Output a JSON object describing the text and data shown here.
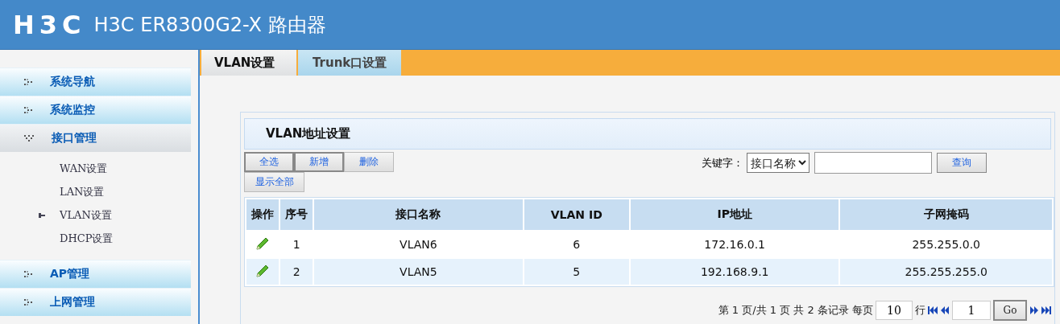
{
  "header": {
    "logo": "H3C",
    "title": "H3C ER8300G2-X 路由器"
  },
  "sidebar": {
    "items": [
      {
        "label": "系统导航",
        "expanded": false
      },
      {
        "label": "系统监控",
        "expanded": false
      },
      {
        "label": "接口管理",
        "expanded": true,
        "children": [
          {
            "label": "WAN设置",
            "selected": false
          },
          {
            "label": "LAN设置",
            "selected": false
          },
          {
            "label": "VLAN设置",
            "selected": true
          },
          {
            "label": "DHCP设置",
            "selected": false
          }
        ]
      },
      {
        "label": "AP管理",
        "expanded": false
      },
      {
        "label": "上网管理",
        "expanded": false
      }
    ]
  },
  "tabs": [
    {
      "label": "VLAN设置",
      "selected": true
    },
    {
      "label": "Trunk口设置",
      "selected": false
    }
  ],
  "panel": {
    "title": "VLAN地址设置",
    "buttons": [
      "全选",
      "新增",
      "删除",
      "显示全部"
    ],
    "search": {
      "label": "关键字：",
      "select": "接口名称",
      "button": "查询"
    },
    "table": {
      "columns": [
        "操作",
        "序号",
        "接口名称",
        "VLAN ID",
        "IP地址",
        "子网掩码"
      ],
      "rows": [
        [
          "",
          "1",
          "VLAN6",
          "6",
          "172.16.0.1",
          "255.255.0.0"
        ],
        [
          "",
          "2",
          "VLAN5",
          "5",
          "192.168.9.1",
          "255.255.255.0"
        ]
      ]
    },
    "pagination": {
      "summary": "第 1 页/共 1 页 共 2 条记录 每页",
      "per_page": "10",
      "unit": "行",
      "page": "1",
      "go": "Go"
    }
  }
}
